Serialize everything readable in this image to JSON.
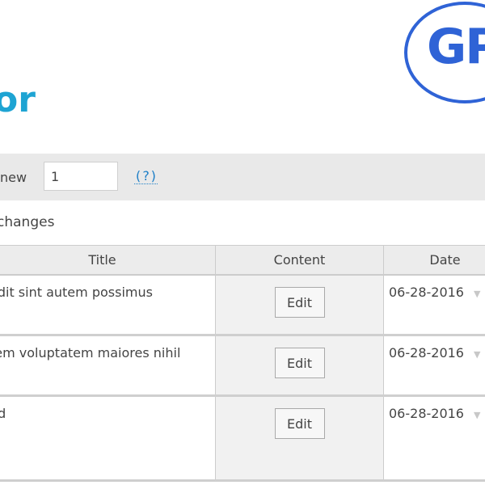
{
  "logo": {
    "text": "GP",
    "color": "#2f63d6"
  },
  "page_heading": "or",
  "settings": {
    "label": "new",
    "input_value": "1",
    "help_link": "(?)"
  },
  "changes_label": "changes",
  "table": {
    "headers": {
      "title": "Title",
      "content": "Content",
      "date": "Date"
    },
    "rows": [
      {
        "title": "edit sint autem possimus",
        "button": "Edit",
        "date": "06-28-2016"
      },
      {
        "title": "tem voluptatem maiores nihil",
        "button": "Edit",
        "date": "06-28-2016"
      },
      {
        "title": "ud",
        "button": "Edit",
        "date": "06-28-2016"
      }
    ]
  },
  "colors": {
    "heading": "#1ea4d3",
    "link": "#1e7fc7",
    "bar": "#e9e9e9"
  }
}
